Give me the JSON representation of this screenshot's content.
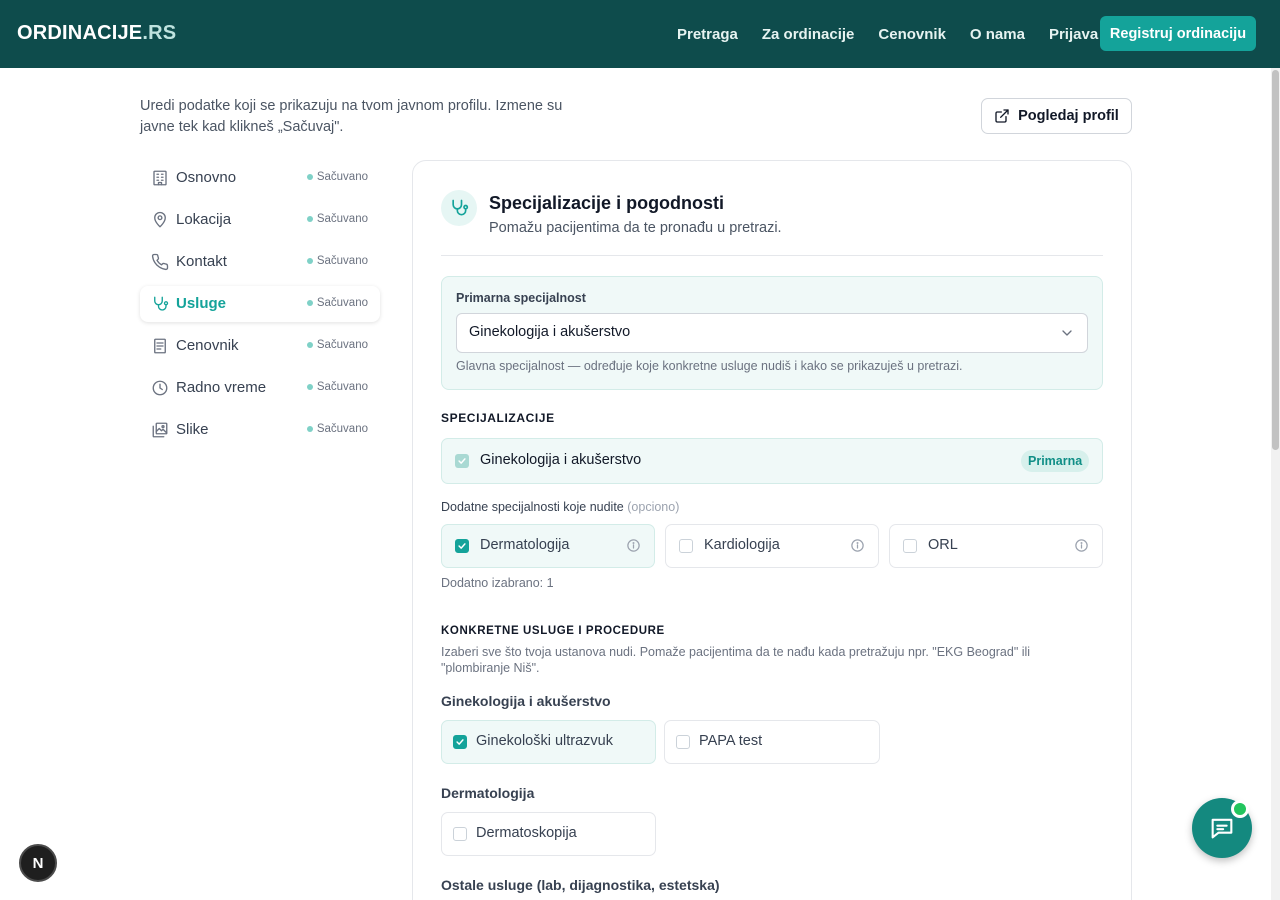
{
  "header": {
    "logo_main": "ORDINACIJE",
    "logo_ext": ".RS",
    "nav": [
      "Pretraga",
      "Za ordinacije",
      "Cenovnik",
      "O nama",
      "Prijava"
    ],
    "cta": "Registruj ordinaciju"
  },
  "intro": {
    "text": "Uredi podatke koji se prikazuju na tvom javnom profilu. Izmene su javne tek kad klikneš „Sačuvaj\".",
    "view_profile": "Pogledaj profil"
  },
  "sidebar": {
    "items": [
      {
        "label": "Osnovno",
        "status": "Sačuvano",
        "icon": "building-icon"
      },
      {
        "label": "Lokacija",
        "status": "Sačuvano",
        "icon": "map-pin-icon"
      },
      {
        "label": "Kontakt",
        "status": "Sačuvano",
        "icon": "phone-icon"
      },
      {
        "label": "Usluge",
        "status": "Sačuvano",
        "icon": "stethoscope-icon",
        "active": true
      },
      {
        "label": "Cenovnik",
        "status": "Sačuvano",
        "icon": "document-icon"
      },
      {
        "label": "Radno vreme",
        "status": "Sačuvano",
        "icon": "clock-icon"
      },
      {
        "label": "Slike",
        "status": "Sačuvano",
        "icon": "images-icon"
      }
    ]
  },
  "section": {
    "title": "Specijalizacije i pogodnosti",
    "subtitle": "Pomažu pacijentima da te pronađu u pretrazi."
  },
  "primary": {
    "label": "Primarna specijalnost",
    "value": "Ginekologija i akušerstvo",
    "help": "Glavna specijalnost — određuje koje konkretne usluge nudiš i kako se prikazuješ u pretrazi."
  },
  "specializations": {
    "heading": "SPECIJALIZACIJE",
    "primary_item": "Ginekologija i akušerstvo",
    "primary_badge": "Primarna",
    "additional_label": "Dodatne specijalnosti koje nudite",
    "additional_optional": "(opciono)",
    "options": [
      {
        "label": "Dermatologija",
        "checked": true
      },
      {
        "label": "Kardiologija",
        "checked": false
      },
      {
        "label": "ORL",
        "checked": false
      }
    ],
    "count_text": "Dodatno izabrano: 1"
  },
  "services": {
    "heading": "KONKRETNE USLUGE I PROCEDURE",
    "description": "Izaberi sve što tvoja ustanova nudi. Pomaže pacijentima da te nađu kada pretražuju npr. \"EKG Beograd\" ili \"plombiranje Niš\".",
    "groups": [
      {
        "title": "Ginekologija i akušerstvo",
        "items": [
          {
            "label": "Ginekološki ultrazvuk",
            "checked": true
          },
          {
            "label": "PAPA test",
            "checked": false
          }
        ]
      },
      {
        "title": "Dermatologija",
        "items": [
          {
            "label": "Dermatoskopija",
            "checked": false
          }
        ]
      },
      {
        "title": "Ostale usluge (lab, dijagnostika, estetska)",
        "items": []
      }
    ]
  },
  "floating": {
    "dev_badge": "N"
  },
  "colors": {
    "header_bg": "#0e4c4c",
    "accent": "#14a39a",
    "light_accent_bg": "#f0f9f8"
  }
}
